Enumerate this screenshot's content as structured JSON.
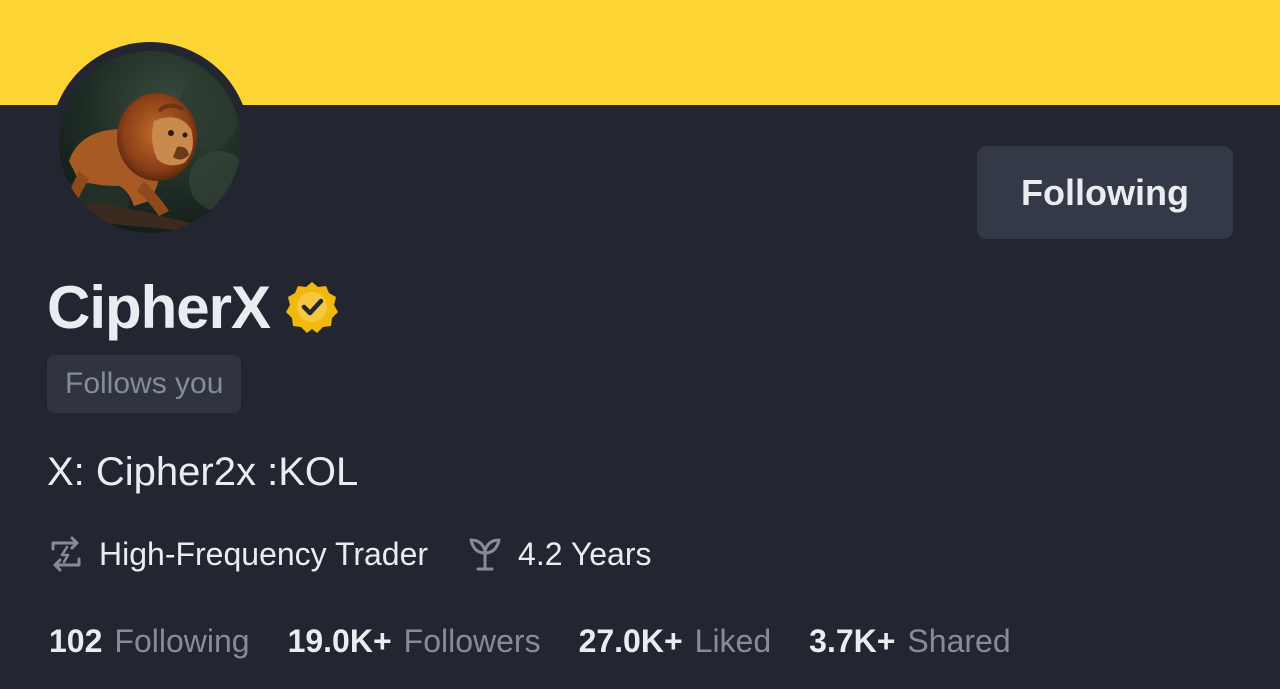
{
  "banner": {
    "color": "#fcd535"
  },
  "profile": {
    "avatar_icon": "lion-avatar",
    "name": "CipherX",
    "verified_icon": "verified-badge-icon",
    "follows_you": "Follows you",
    "bio": "X: Cipher2x :KOL",
    "follow_button": "Following"
  },
  "tags": [
    {
      "icon": "swap-arrows-icon",
      "label": "High-Frequency Trader"
    },
    {
      "icon": "sprout-icon",
      "label": "4.2 Years"
    }
  ],
  "stats": [
    {
      "value": "102",
      "label": "Following"
    },
    {
      "value": "19.0K+",
      "label": "Followers"
    },
    {
      "value": "27.0K+",
      "label": "Liked"
    },
    {
      "value": "3.7K+",
      "label": "Shared"
    }
  ],
  "colors": {
    "background": "#232631",
    "accent": "#fcd535",
    "text_primary": "#eaecef",
    "text_secondary": "#858c99",
    "button_bg": "#343947"
  }
}
